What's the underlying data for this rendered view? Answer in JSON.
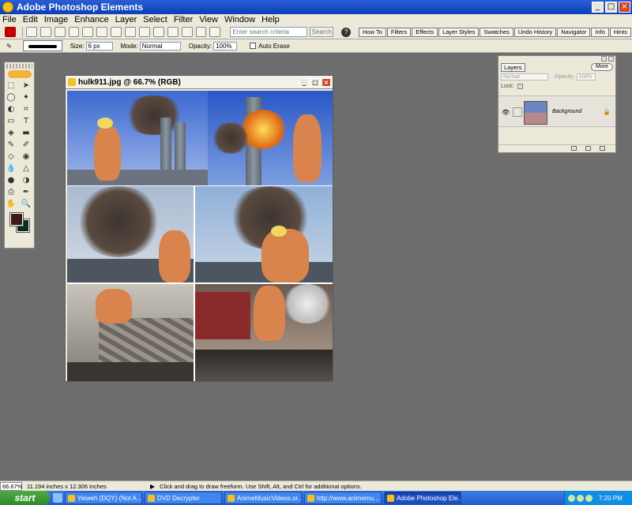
{
  "window": {
    "title": "Adobe Photoshop Elements",
    "minimize_glyph": "_",
    "maximize_glyph": "□",
    "close_glyph": "×"
  },
  "menu": [
    "File",
    "Edit",
    "Image",
    "Enhance",
    "Layer",
    "Select",
    "Filter",
    "View",
    "Window",
    "Help"
  ],
  "toolbar": {
    "search_placeholder": "Enter search criteria",
    "search_button": "Search",
    "help_glyph": "?",
    "palette_tabs": [
      "How To",
      "Filters",
      "Effects",
      "Layer Styles",
      "Swatches",
      "Undo History",
      "Navigator",
      "Info",
      "Hints"
    ]
  },
  "options": {
    "size_label": "Size:",
    "size_value": "6 px",
    "mode_label": "Mode:",
    "mode_value": "Normal",
    "opacity_label": "Opacity:",
    "opacity_value": "100%",
    "auto_erase_label": "Auto Erase"
  },
  "toolbox": {
    "tools": [
      "marquee-tool",
      "move-tool",
      "lasso-tool",
      "magic-wand-tool",
      "selection-brush-tool",
      "crop-tool",
      "shape-tool",
      "type-tool",
      "paint-bucket-tool",
      "gradient-tool",
      "pencil-tool",
      "brush-tool",
      "eraser-tool",
      "red-eye-brush-tool",
      "blur-tool",
      "sharpen-tool",
      "sponge-tool",
      "dodge-tool",
      "clone-stamp-tool",
      "eyedropper-tool",
      "hand-tool",
      "zoom-tool"
    ],
    "glyphs": [
      "⬚",
      "➤",
      "◯",
      "✦",
      "◐",
      "⌗",
      "▭",
      "T",
      "◈",
      "▬",
      "✎",
      "✐",
      "◇",
      "◉",
      "💧",
      "△",
      "●",
      "◑",
      "⎙",
      "✒",
      "✋",
      "🔍"
    ],
    "foreground_color": "#3a1c14",
    "background_color": "#0d2a20"
  },
  "document": {
    "title": "hulk911.jpg @ 66.7% (RGB)"
  },
  "layers": {
    "tab": "Layers",
    "more_button": "More",
    "blend_mode": "Normal",
    "opacity_label": "Opacity:",
    "opacity_value": "100%",
    "lock_label": "Lock:",
    "layer_name": "Background",
    "eye_glyph": "👁",
    "lock_glyph": "🔒"
  },
  "status": {
    "zoom": "66.67%",
    "doc_size": "11.194 inches x 12.306 inches",
    "arrow_glyph": "▶",
    "hint": "Click and drag to draw freeform.  Use Shift, Alt, and Ctrl for additional options."
  },
  "taskbar": {
    "start": "start",
    "tasks": [
      "Yeiweh (DQY) (Not A...",
      "DVD Decrypter",
      "AnimeMusicVideos.or...",
      "http://www.animemu...",
      "Adobe Photoshop Ele..."
    ],
    "clock": "7:20 PM"
  }
}
